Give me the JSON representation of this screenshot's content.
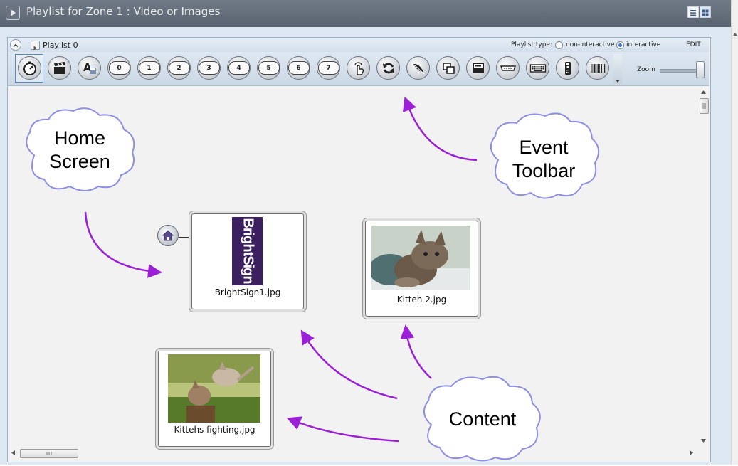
{
  "window": {
    "title": "Playlist for Zone 1 : Video or Images"
  },
  "playlist": {
    "name": "Playlist 0",
    "type_label": "Playlist type:",
    "type_options": [
      "non-interactive",
      "interactive"
    ],
    "selected_type": "interactive",
    "edit_label": "EDIT"
  },
  "toolbar": {
    "number_buttons": [
      "0",
      "1",
      "2",
      "3",
      "4",
      "5",
      "6",
      "7"
    ],
    "icons": [
      "timer-icon",
      "clapperboard-icon",
      "text-icon",
      "hand-touch-icon",
      "refresh-icon",
      "feather-icon",
      "copy-icon",
      "monitor-icon",
      "serial-port-icon",
      "keyboard-icon",
      "remote-icon",
      "barcode-icon"
    ],
    "zoom_label": "Zoom"
  },
  "content_items": [
    {
      "label": "BrightSign1.jpg",
      "logo_text": "BrightSign"
    },
    {
      "label": "Kitteh 2.jpg"
    },
    {
      "label": "Kittehs fighting.jpg"
    }
  ],
  "annotations": {
    "home_screen": [
      "Home",
      "Screen"
    ],
    "event_toolbar": [
      "Event",
      "Toolbar"
    ],
    "content": "Content",
    "arrow_color": "#9b1fd6",
    "cloud_outline": "#8e8fe0"
  }
}
